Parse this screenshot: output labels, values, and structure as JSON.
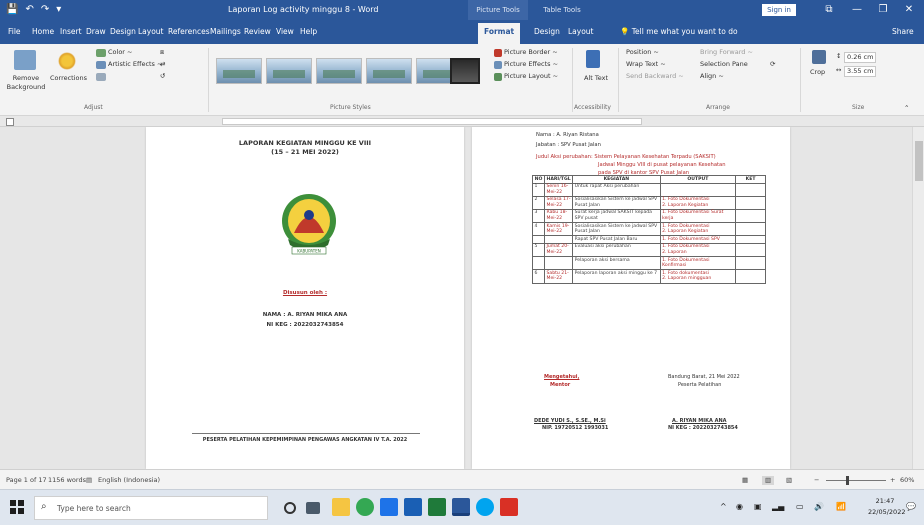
{
  "window": {
    "title": "Laporan Log activity minggu 8  -  Word",
    "context_tab_picture": "Picture Tools",
    "context_tab_table": "Table Tools",
    "sign_in": "Sign in",
    "minimize": "—",
    "restore": "❐",
    "close": "✕"
  },
  "tabs": [
    "File",
    "Home",
    "Insert",
    "Draw",
    "Design",
    "Layout",
    "References",
    "Mailings",
    "Review",
    "View",
    "Help",
    "Format",
    "Design",
    "Layout"
  ],
  "tell_me": "Tell me what you want to do",
  "share": "Share",
  "ribbon": {
    "remove_background": "Remove Background",
    "corrections": "Corrections",
    "color": "Color ~",
    "artistic_effects": "Artistic Effects ~",
    "adjust_label": "Adjust",
    "picture_styles_label": "Picture Styles",
    "picture_border": "Picture Border ~",
    "picture_effects": "Picture Effects ~",
    "picture_layout": "Picture Layout ~",
    "alt_text": "Alt Text",
    "accessibility_label": "Accessibility",
    "position": "Position ~",
    "wrap_text": "Wrap Text ~",
    "bring_forward": "Bring Forward ~",
    "send_backward": "Send Backward ~",
    "selection_pane": "Selection Pane",
    "align": "Align ~",
    "arrange_label": "Arrange",
    "crop": "Crop",
    "height": "0.26 cm",
    "width": "3.55 cm",
    "size_label": "Size"
  },
  "page1": {
    "title_line1": "LAPORAN KEGIATAN MINGGU KE VIII",
    "title_line2": "(15 – 21 MEI 2022)",
    "logo_text": "KABUPATEN",
    "disusun": "Disusun oleh :",
    "nama": "NAMA : A. RIYAN MIKA ANA",
    "nip": "NI KEG : 2022032743854",
    "footer": "PESERTA PELATIHAN KEPEMIMPINAN PENGAWAS ANGKATAN IV T.A. 2022"
  },
  "page2": {
    "nama_line": "Nama           : A. Riyan Ristana",
    "jabatan_line": "Jabatan        : SPV Pusat Jalan",
    "judul_line": "Judul Aksi perubahan: Sistem Pelayanan Kesehatan Terpadu (SAKSIT)",
    "judul_line2": "Jadwal Minggu VIII di pusat pelayanan Kesehatan",
    "judul_line3": "pada SPV di kantor SPV Pusat Jalan",
    "table": {
      "headers": [
        "NO",
        "HARI/TGL",
        "KEGIATAN",
        "OUTPUT",
        "KET"
      ],
      "rows": [
        [
          "1",
          "Senin 16-Mei-22",
          "Untuk rapat Aksi perubahan",
          "",
          ""
        ],
        [
          "2",
          "Selasa 17-Mei-22",
          "Sosialisasikan Sistem ke jadwal SPV Pusat Jalan",
          "1. Foto Dokumentasi\n2. Laporan Kegiatan",
          ""
        ],
        [
          "3",
          "Rabu 18-Mei-22",
          "Surat kerja jadwal SAKSIT kepada SPV pusat",
          "1. Foto Dokumentasi Surat kerja",
          ""
        ],
        [
          "4",
          "Kamis 19-Mei-22",
          "Sosialisasikan Sistem ke jadwal SPV Pusat Jalan",
          "1. Foto Dokumentasi\n2. Laporan Kegiatan",
          ""
        ],
        [
          "",
          "",
          "Rapat SPV Pusat Jalan Baru",
          "1. Foto Dokumentasi SPV",
          ""
        ],
        [
          "5",
          "Jumat 20-Mei-22",
          "Evaluasi aksi perubahan",
          "1. Foto Dokumentasi\n2. Laporan",
          ""
        ],
        [
          "",
          "",
          "Pelaporan aksi bersama",
          "1. Foto Dokumentasi Konfirmasi",
          ""
        ],
        [
          "6",
          "Sabtu 21-Mei-22",
          "Pelaporan laporan aksi minggu ke 7",
          "1. Foto dokumentasi\n2. Laporan mingguan",
          ""
        ]
      ]
    },
    "mengetahui": "Mengetahui,",
    "mentor": "Mentor",
    "place_date": "Bandung Barat, 21 Mei 2022",
    "role": "Peserta Pelatihan",
    "mentor_name": "DEDE YUDI S., S.SE., M.Si",
    "mentor_nip": "NIP. 19720512 1993031",
    "participant_name": "A. RIYAN MIKA ANA",
    "participant_nip": "NI KEG : 2022032743854"
  },
  "status": {
    "page": "Page 1 of 17",
    "words": "1156 words",
    "language": "English (Indonesia)",
    "zoom": "60%"
  },
  "taskbar": {
    "search_placeholder": "Type here to search",
    "time": "21:47",
    "date": "22/05/2022"
  }
}
